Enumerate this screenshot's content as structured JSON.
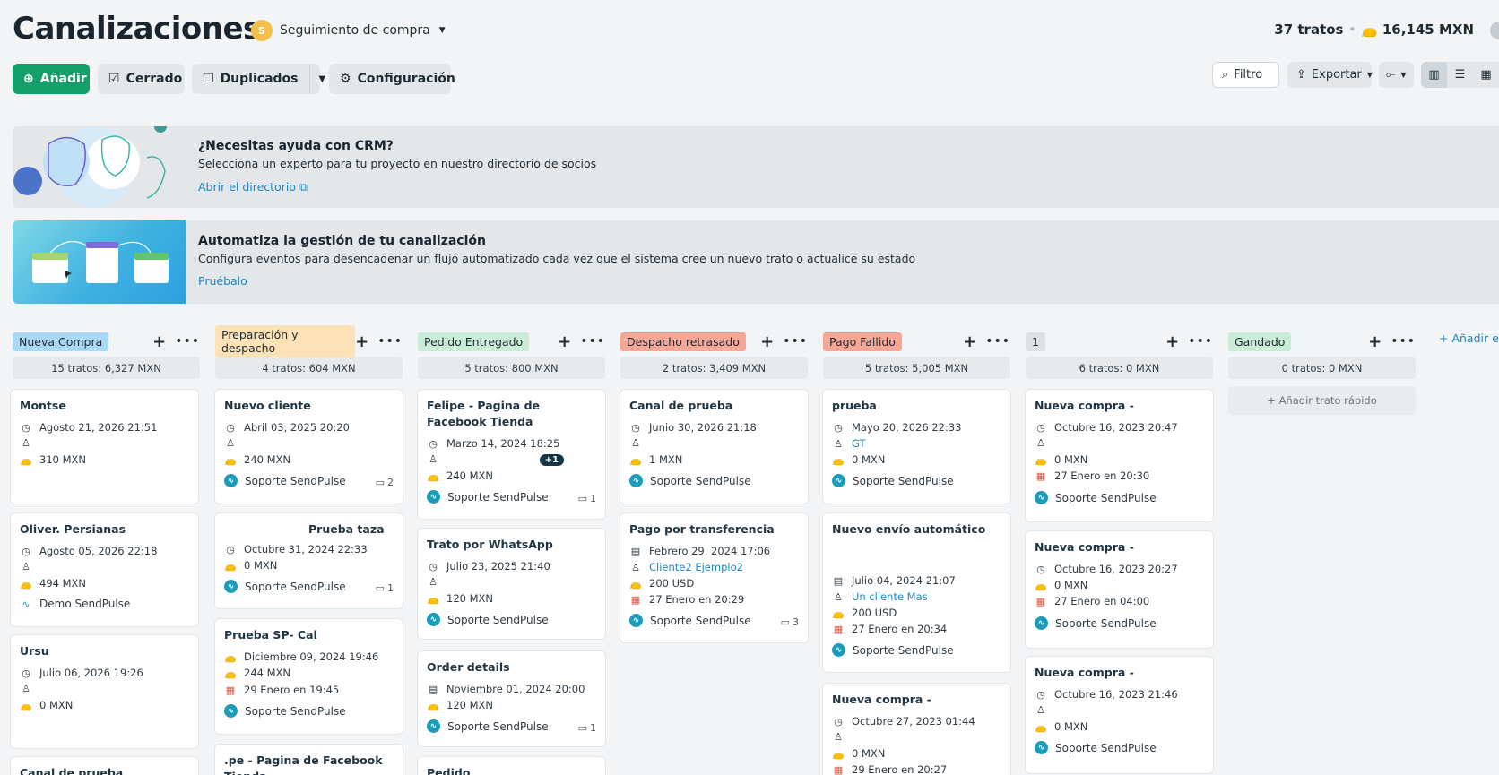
{
  "header": {
    "title": "Canalizaciones",
    "pipeline_avatar": "S",
    "pipeline_name": "Seguimiento de compra",
    "deals_count": "37 tratos",
    "total_amount": "16,145 MXN"
  },
  "toolbar": {
    "add": "Añadir",
    "closed": "Cerrado",
    "duplicates": "Duplicados",
    "settings": "Configuración",
    "filter": "Filtro",
    "export": "Exportar"
  },
  "banners": {
    "help": {
      "title": "¿Necesitas ayuda con CRM?",
      "desc": "Selecciona un experto para tu proyecto en nuestro directorio de socios",
      "link": "Abrir el directorio"
    },
    "automation": {
      "title": "Automatiza la gestión de tu canalización",
      "desc": "Configura eventos para desencadenar un flujo automatizado cada vez que el sistema cree un nuevo trato o actualice su estado",
      "link": "Pruébalo"
    }
  },
  "columns": [
    {
      "name": "Nueva Compra",
      "color": "#a9d8f5",
      "total": "15 tratos: 6,327 MXN"
    },
    {
      "name": "Preparación y despacho",
      "color": "#fde2b8",
      "total": "4 tratos: 604 MXN"
    },
    {
      "name": "Pedido Entregado",
      "color": "#c9ecd6",
      "total": "5 tratos: 800 MXN"
    },
    {
      "name": "Despacho retrasado",
      "color": "#f5a695",
      "total": "2 tratos: 3,409 MXN"
    },
    {
      "name": "Pago Fallido",
      "color": "#f5a695",
      "total": "5 tratos: 5,005 MXN"
    },
    {
      "name": "1",
      "color": "#dde1e4",
      "total": "6 tratos: 0 MXN"
    },
    {
      "name": "Gandado",
      "color": "#c9ecd6",
      "total": "0 tratos: 0 MXN",
      "quick_add": "Añadir trato rápido"
    }
  ],
  "add_stage": "Añadir etapa",
  "cards": {
    "c1": [
      {
        "title": "Montse",
        "date": "Agosto 21, 2026 21:51",
        "amount": "310 MXN"
      },
      {
        "title": "Oliver. Persianas",
        "date": "Agosto 05, 2026 22:18",
        "amount": "494 MXN",
        "owner": "Demo SendPulse"
      },
      {
        "title": "Ursu",
        "date": "Julio 06, 2026 19:26",
        "amount": "0 MXN"
      },
      {
        "title": "Canal de prueba"
      }
    ],
    "c2": [
      {
        "title": "Nuevo cliente",
        "date": "Abril 03, 2025 20:20",
        "amount": "240 MXN",
        "owner": "Soporte SendPulse",
        "comments": "2"
      },
      {
        "title": "Prueba taza",
        "date": "Octubre 31, 2024 22:33",
        "amount": "0 MXN",
        "owner": "Soporte SendPulse",
        "comments": "1"
      },
      {
        "title": "Prueba SP- Cal",
        "date": "Diciembre 09, 2024 19:46",
        "amount": "244 MXN",
        "task": "29 Enero en 19:45",
        "owner": "Soporte SendPulse"
      },
      {
        "title": ".pe - Pagina de Facebook Tienda"
      }
    ],
    "c3": [
      {
        "title": "Felipe - Pagina de Facebook Tienda",
        "date": "Marzo 14, 2024 18:25",
        "badge": "+1",
        "amount": "240 MXN",
        "owner": "Soporte SendPulse",
        "comments": "1"
      },
      {
        "title": "Trato por WhatsApp",
        "date": "Julio 23, 2025 21:40",
        "amount": "120 MXN",
        "owner": "Soporte SendPulse"
      },
      {
        "title": "Order details",
        "date": "Noviembre 01, 2024 20:00",
        "amount": "120 MXN",
        "owner": "Soporte SendPulse",
        "comments": "1"
      },
      {
        "title": "Pedido"
      }
    ],
    "c4": [
      {
        "title": "Canal de prueba",
        "date": "Junio 30, 2026 21:18",
        "amount": "1 MXN",
        "owner": "Soporte SendPulse"
      },
      {
        "title": "Pago por transferencia",
        "date": "Febrero 29, 2024 17:06",
        "contact": "Cliente2 Ejemplo2",
        "amount": "200 USD",
        "task": "27 Enero en 20:29",
        "owner": "Soporte SendPulse",
        "comments": "3"
      }
    ],
    "c5": [
      {
        "title": "prueba",
        "date": "Mayo 20, 2026 22:33",
        "contact": "GT",
        "amount": "0 MXN",
        "owner": "Soporte SendPulse"
      },
      {
        "title": "Nuevo envío automático",
        "date": "Julio 04, 2024 21:07",
        "contact": "Un cliente Mas",
        "amount": "200 USD",
        "task": "27 Enero en 20:34",
        "owner": "Soporte SendPulse"
      },
      {
        "title": "Nueva compra -",
        "date": "Octubre 27, 2023 01:44",
        "amount": "0 MXN",
        "task": "29 Enero en 20:27"
      }
    ],
    "c6": [
      {
        "title": "Nueva compra -",
        "date": "Octubre 16, 2023 20:47",
        "amount": "0 MXN",
        "task": "27 Enero en 20:30",
        "owner": "Soporte SendPulse"
      },
      {
        "title": "Nueva compra -",
        "date": "Octubre 16, 2023 20:27",
        "amount": "0 MXN",
        "task": "27 Enero en 04:00",
        "owner": "Soporte SendPulse"
      },
      {
        "title": "Nueva compra -",
        "date": "Octubre 16, 2023 21:46",
        "amount": "0 MXN",
        "owner": "Soporte SendPulse"
      }
    ]
  }
}
